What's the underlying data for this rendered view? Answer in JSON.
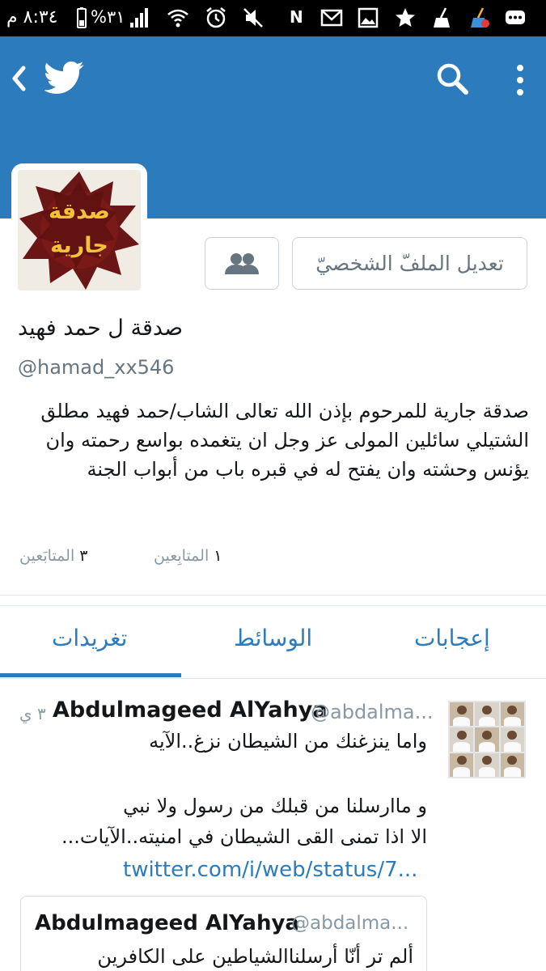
{
  "status_bar": {
    "time": "٨:٣٤ م",
    "battery_percent": "٣١%",
    "network_letter": "N",
    "icons": [
      "battery-icon",
      "signal-icon",
      "wifi-icon",
      "alarm-icon",
      "mute-icon",
      "gmail-icon",
      "gallery-icon",
      "star-icon",
      "cleaner-icon",
      "cleaner-alert-icon",
      "messenger-icon"
    ]
  },
  "header": {
    "icons": [
      "back-icon",
      "twitter-bird-icon",
      "search-icon",
      "more-vertical-icon"
    ],
    "colors": {
      "banner": "#2b7bbd",
      "accent": "#2b7bbd"
    }
  },
  "profile": {
    "avatar_text_line1": "صدقة",
    "avatar_text_line2": "جارية",
    "name": "صدقة ل حمد فهيد",
    "handle": "@hamad_xx546",
    "bio": "صدقة جارية للمرحوم بإذن الله تعالى الشاب/حمد فهيد مطلق الشتيلي  سائلين المولى عز وجل ان يتغمده بواسع رحمته وان يؤنس وحشته وان يفتح له في قبره باب من أبواب الجنة",
    "edit_button_label": "تعديل الملفّ الشخصيّ",
    "following_count": "١",
    "following_label": "المتابِعين",
    "followers_count": "٣",
    "followers_label": "المتابَعين"
  },
  "tabs": [
    {
      "label": "إعجابات",
      "active": false
    },
    {
      "label": "الوسائط",
      "active": false
    },
    {
      "label": "تغريدات",
      "active": true
    }
  ],
  "tweet": {
    "author": "Abdulmageed  AlYahya",
    "handle": "@abdalma...",
    "time": "٣ ي",
    "lines": [
      "واما ينزغنك من الشيطان نزغ..الآيه",
      "و ماارسلنا من قبلك من رسول ولا نبي",
      "الا اذا تمنى القى الشيطان في امنيته..الآيات..."
    ],
    "link": "twitter.com/i/web/status/7...",
    "quote": {
      "author": "Abdulmageed  AlYahya",
      "handle": "@abdalma...",
      "text": "ألم تر أنّا أرسلناالشياطين على الكافرين"
    }
  }
}
